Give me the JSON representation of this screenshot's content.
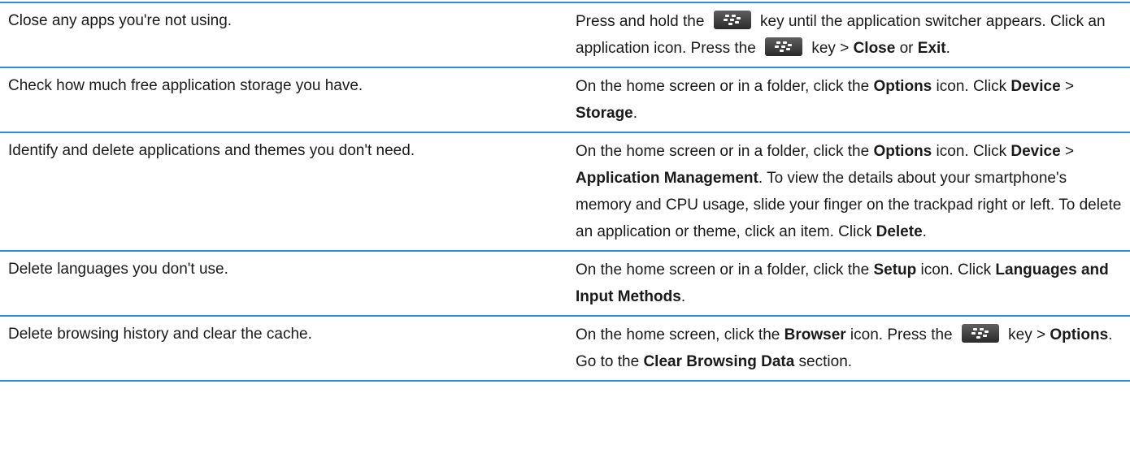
{
  "rows": [
    {
      "task": "Close any apps you're not using.",
      "steps": [
        {
          "t": "Press and hold the "
        },
        {
          "icon": "blackberry-menu-key-icon"
        },
        {
          "t": " key until the application switcher appears. Click an application icon. Press the "
        },
        {
          "icon": "blackberry-menu-key-icon"
        },
        {
          "t": " key > "
        },
        {
          "b": "Close"
        },
        {
          "t": " or "
        },
        {
          "b": "Exit"
        },
        {
          "t": "."
        }
      ]
    },
    {
      "task": "Check how much free application storage you have.",
      "steps": [
        {
          "t": "On the home screen or in a folder, click the "
        },
        {
          "b": "Options"
        },
        {
          "t": " icon. Click "
        },
        {
          "b": "Device"
        },
        {
          "t": " > "
        },
        {
          "b": "Storage"
        },
        {
          "t": "."
        }
      ]
    },
    {
      "task": "Identify and delete applications and themes you don't need.",
      "steps": [
        {
          "t": "On the home screen or in a folder, click the "
        },
        {
          "b": "Options"
        },
        {
          "t": " icon. Click "
        },
        {
          "b": "Device"
        },
        {
          "t": " > "
        },
        {
          "b": "Application Management"
        },
        {
          "t": ". To view the details about your smartphone's memory and CPU usage, slide your finger on the trackpad right or left. To delete an application or theme, click an item. Click "
        },
        {
          "b": "Delete"
        },
        {
          "t": "."
        }
      ]
    },
    {
      "task": "Delete languages you don't use.",
      "steps": [
        {
          "t": "On the home screen or in a folder, click the "
        },
        {
          "b": "Setup"
        },
        {
          "t": " icon. Click "
        },
        {
          "b": "Languages and Input Methods"
        },
        {
          "t": "."
        }
      ]
    },
    {
      "task": "Delete browsing history and clear the cache.",
      "steps": [
        {
          "t": "On the home screen, click the "
        },
        {
          "b": "Browser"
        },
        {
          "t": " icon. Press the "
        },
        {
          "icon": "blackberry-menu-key-icon"
        },
        {
          "t": " key > "
        },
        {
          "b": "Options"
        },
        {
          "t": ". Go to the "
        },
        {
          "b": "Clear Browsing Data"
        },
        {
          "t": " section."
        }
      ]
    }
  ],
  "colors": {
    "rule": "#2d8ed8",
    "text": "#1a1a1a",
    "key_bg": "#3a3a3a"
  }
}
